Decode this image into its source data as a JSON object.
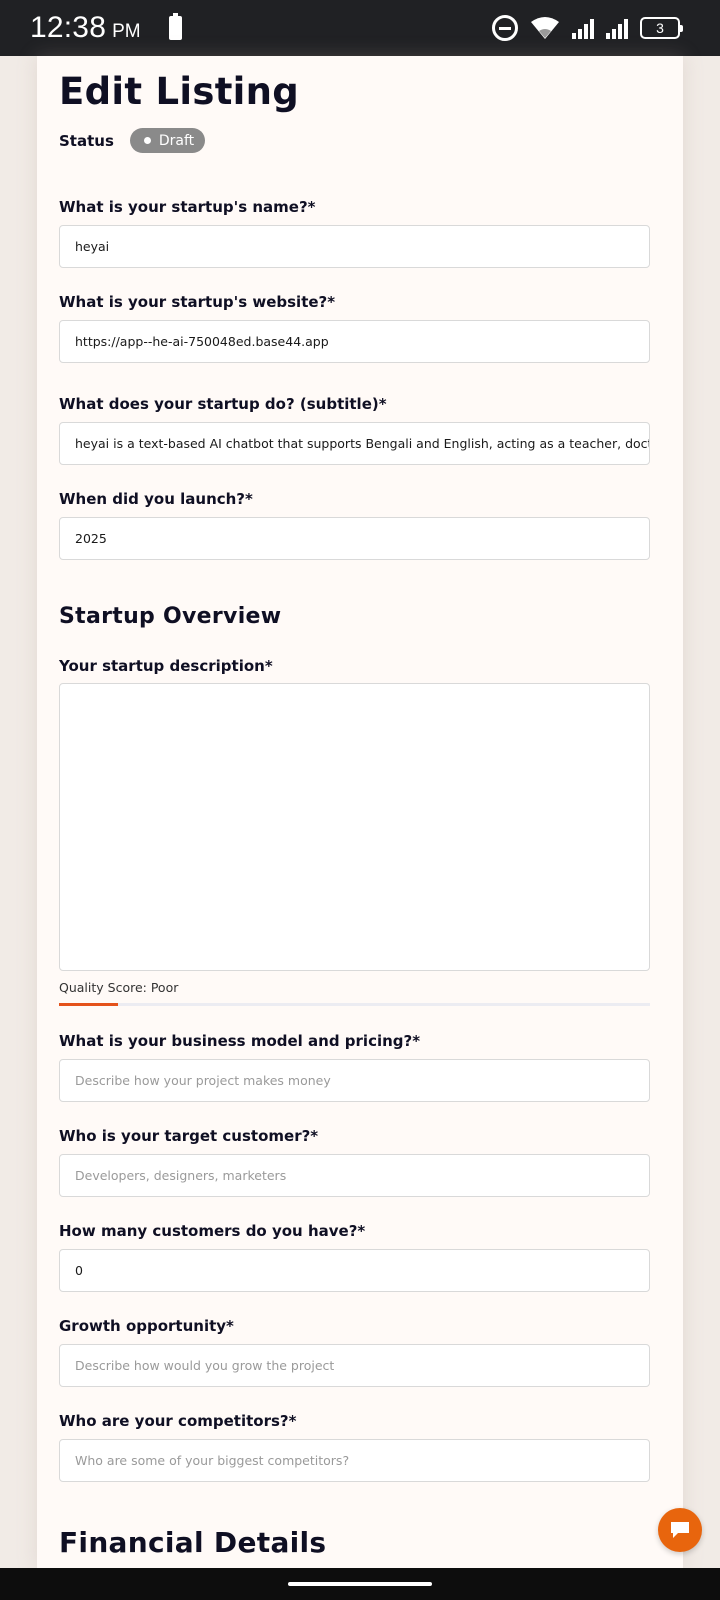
{
  "status_bar": {
    "time": "12:38",
    "ampm": "PM",
    "battery_level": "3",
    "icons": [
      "battery-icon",
      "do-not-disturb-icon",
      "wifi-icon",
      "signal-icon",
      "signal-icon",
      "battery-icon"
    ]
  },
  "page": {
    "title": "Edit Listing",
    "status_label": "Status",
    "status_value": "Draft"
  },
  "fields": {
    "name": {
      "label": "What is your startup's name?*",
      "value": "heyai"
    },
    "website": {
      "label": "What is your startup's website?*",
      "value": "https://app--he-ai-750048ed.base44.app"
    },
    "subtitle": {
      "label": "What does your startup do? (subtitle)*",
      "value": "heyai is a text-based AI chatbot that supports Bengali and English, acting as a teacher, doctor, lawyer"
    },
    "launch": {
      "label": "When did you launch?*",
      "value": "2025"
    }
  },
  "overview": {
    "title": "Startup Overview",
    "description_label": "Your startup description*",
    "description_value": "",
    "quality_score_text": "Quality Score: Poor",
    "quality_score_fraction": 0.1,
    "business_model": {
      "label": "What is your business model and pricing?*",
      "placeholder": "Describe how your project makes money"
    },
    "target_customer": {
      "label": "Who is your target customer?*",
      "placeholder": "Developers, designers, marketers"
    },
    "customers": {
      "label": "How many customers do you have?*",
      "value": "0"
    },
    "growth": {
      "label": "Growth opportunity*",
      "placeholder": "Describe how would you grow the project"
    },
    "competitors": {
      "label": "Who are your competitors?*",
      "placeholder": "Who are some of your biggest competitors?"
    }
  },
  "next_section_title": "Financial Details",
  "colors": {
    "accent": "#e4521b",
    "fab": "#e8650d",
    "badge": "#8a8a8a",
    "card_bg": "#fffaf7",
    "page_bg": "#f1ebe6"
  }
}
